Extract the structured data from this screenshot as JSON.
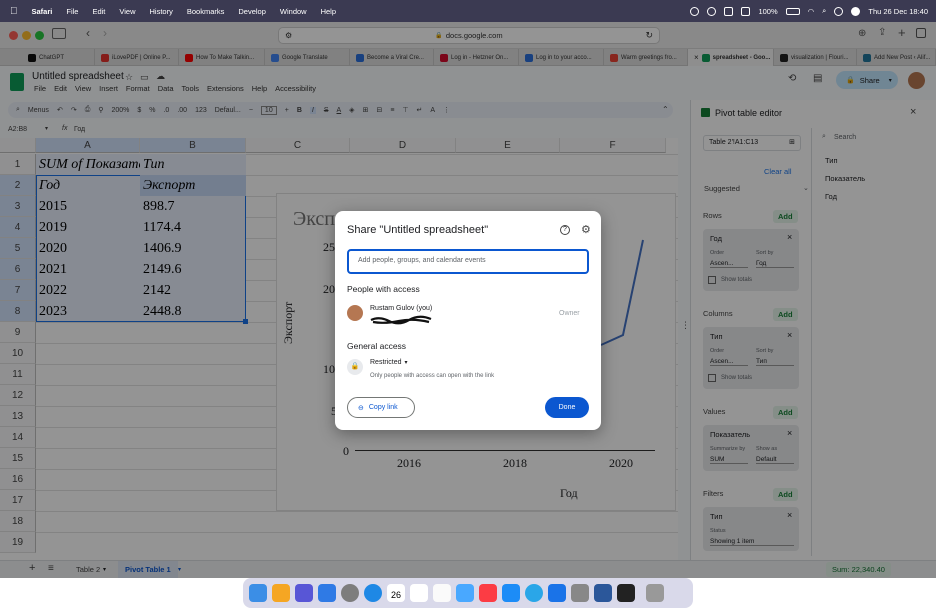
{
  "menubar": {
    "apple": "",
    "app": "Safari",
    "items": [
      "File",
      "Edit",
      "View",
      "History",
      "Bookmarks",
      "Develop",
      "Window",
      "Help"
    ],
    "battery": "100%",
    "datetime": "Thu 26 Dec  18:40"
  },
  "safari": {
    "url": "docs.google.com"
  },
  "tabs": [
    {
      "label": "ChatGPT",
      "color": "#111111"
    },
    {
      "label": "iLovePDF | Online P...",
      "color": "#e5322d"
    },
    {
      "label": "How To Make Talkin...",
      "color": "#ff0000"
    },
    {
      "label": "Google Translate",
      "color": "#4285f4"
    },
    {
      "label": "Become a Viral Cre...",
      "color": "#2a6fdb"
    },
    {
      "label": "Log in - Hetzner On...",
      "color": "#d50c2d"
    },
    {
      "label": "Log in to your acco...",
      "color": "#2a6fdb"
    },
    {
      "label": "Warm greetings fro...",
      "color": "#ea4335"
    },
    {
      "label": "spreadsheet - Goo...",
      "color": "#0f9d58"
    },
    {
      "label": "visualization | Flouri...",
      "color": "#222222"
    },
    {
      "label": "Add New Post ‹ Alif...",
      "color": "#21759b"
    }
  ],
  "doc": {
    "title": "Untitled spreadsheet",
    "menus": [
      "File",
      "Edit",
      "View",
      "Insert",
      "Format",
      "Data",
      "Tools",
      "Extensions",
      "Help",
      "Accessibility"
    ],
    "share": "Share",
    "toolbar": {
      "menus": "Menus",
      "zoom": "200%",
      "currency": "$",
      "percent": "%",
      "dec1": ".0",
      "dec2": ".00",
      "num": "123",
      "font": "Defaul...",
      "size": "10"
    },
    "cellref": "A2:B8",
    "fx": "Год"
  },
  "grid": {
    "columns": [
      "A",
      "B",
      "C",
      "D",
      "E",
      "F"
    ],
    "rows": [
      "1",
      "2",
      "3",
      "4",
      "5",
      "6",
      "7",
      "8",
      "9",
      "10",
      "11",
      "12",
      "13",
      "14",
      "15",
      "16",
      "17",
      "18",
      "19"
    ],
    "r1": {
      "a": "SUM of Показате",
      "b": "Тип"
    },
    "r2": {
      "a": "Год",
      "b": "Экспорт"
    },
    "data": [
      {
        "year": "2015",
        "value": "898.7"
      },
      {
        "year": "2019",
        "value": "1174.4"
      },
      {
        "year": "2020",
        "value": "1406.9"
      },
      {
        "year": "2021",
        "value": "2149.6"
      },
      {
        "year": "2022",
        "value": "2142"
      },
      {
        "year": "2023",
        "value": "2448.8"
      }
    ]
  },
  "chart": {
    "title": "Эксп",
    "ylabel": "Экспорт",
    "xlabel": "Год",
    "yticks": [
      "25",
      "20",
      "15",
      "10",
      "5",
      "0"
    ],
    "xticks": [
      "2016",
      "2018",
      "2020"
    ]
  },
  "dialog": {
    "title": "Share \"Untitled spreadsheet\"",
    "placeholder": "Add people, groups, and calendar events",
    "people_heading": "People with access",
    "person_name": "Rustam Gulov (you)",
    "owner": "Owner",
    "general_heading": "General access",
    "access_level": "Restricted",
    "access_desc": "Only people with access can open with the link",
    "copy_link": "Copy link",
    "done": "Done"
  },
  "pivot": {
    "title": "Pivot table editor",
    "range": "Table 2'!A1:C13",
    "search": "Search",
    "fields": [
      "Тип",
      "Показатель",
      "Год"
    ],
    "suggested": "Suggested",
    "clear_all": "Clear all",
    "rows": "Rows",
    "columns": "Columns",
    "values": "Values",
    "filters": "Filters",
    "add": "Add",
    "order": "Order",
    "sortby": "Sort by",
    "row_field": "Год",
    "row_order": "Ascen...",
    "row_sort": "Год",
    "show_totals": "Show totals",
    "col_field": "Тип",
    "col_order": "Ascen...",
    "col_sort": "Тип",
    "val_field": "Показатель",
    "summarize": "Summarize by",
    "show_as": "Show as",
    "summarize_val": "SUM",
    "show_as_val": "Default",
    "filter_field": "Тип",
    "status": "Status",
    "status_val": "Showing 1 item"
  },
  "sheets": {
    "add": "+",
    "tabs": [
      "Table 2",
      "Pivot Table 1"
    ],
    "sum": "Sum: 22,340.40"
  },
  "dock": {
    "calendar_day": "26",
    "apps": [
      "#3b8ee6",
      "#f5a623",
      "#5856d6",
      "#2f7ae5",
      "#7d7d7d",
      "#1e88e5",
      "#ffffff",
      "#ffffff",
      "#fafafa",
      "#49a8ff",
      "#fc3c44",
      "#1c8cf7",
      "#2aa6e8",
      "#1a73e8",
      "#888888",
      "#2b579a",
      "#222222",
      "#999999"
    ]
  }
}
